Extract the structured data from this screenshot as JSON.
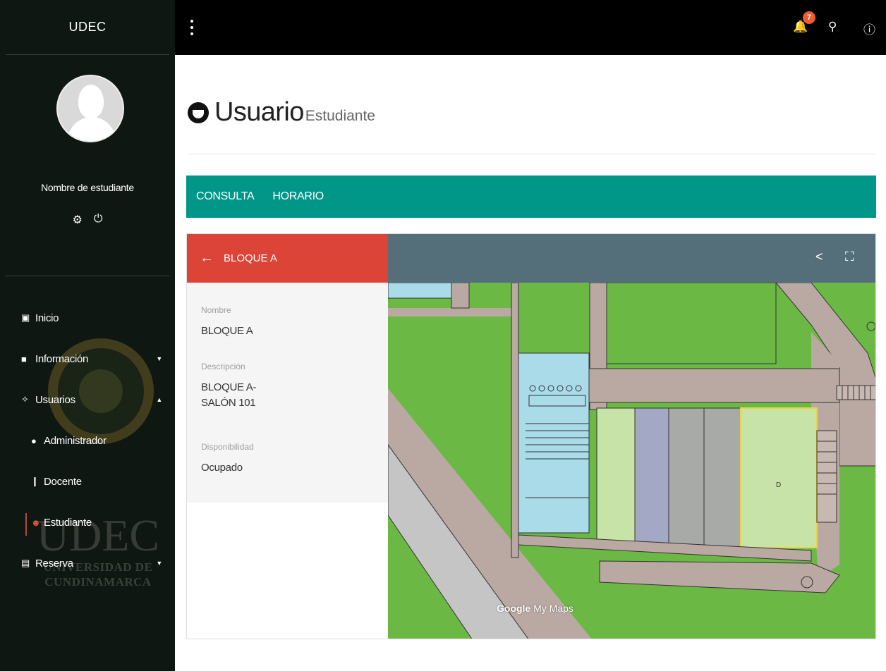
{
  "sidebar": {
    "brand": "UDEC",
    "student_name": "Nombre de estudiante",
    "watermark": {
      "line1": "UDEC",
      "line2": "UNIVERSIDAD DE",
      "line3": "CUNDINAMARCA"
    },
    "nav": [
      {
        "label": "Inicio",
        "icon": "dashboard-icon"
      },
      {
        "label": "Información",
        "icon": "briefcase-icon"
      },
      {
        "label": "Usuarios",
        "icon": "users-icon"
      },
      {
        "label": "Administrador",
        "icon": "person-icon"
      },
      {
        "label": "Docente",
        "icon": "standing-person-icon"
      },
      {
        "label": "Estudiante",
        "icon": "face-icon"
      },
      {
        "label": "Reserva",
        "icon": "calendar-icon"
      }
    ]
  },
  "topbar": {
    "notification_count": "7"
  },
  "header": {
    "title": "Usuario",
    "subtitle": "Estudiante"
  },
  "tabs": [
    {
      "label": "CONSULTA"
    },
    {
      "label": "HORARIO"
    }
  ],
  "map": {
    "panel_title": "BLOQUE A",
    "fields": [
      {
        "label": "Nombre",
        "value": "BLOQUE A"
      },
      {
        "label": "Descripción",
        "value": "BLOQUE A-\nSALÓN 101"
      },
      {
        "label": "Disponibilidad",
        "value": "Ocupado"
      }
    ],
    "attribution_google": "Google",
    "attribution_mymaps": "My Maps",
    "room_marker": "D"
  }
}
